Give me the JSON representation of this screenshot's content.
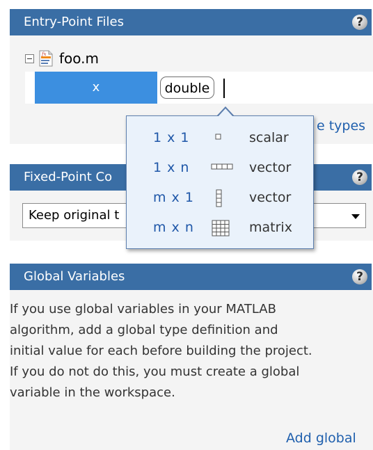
{
  "entry_points": {
    "header": "Entry-Point Files",
    "help": "?",
    "file": "foo.m",
    "variable": "x",
    "type_value": "double",
    "types_link": "e types"
  },
  "fixed_point": {
    "header": "Fixed-Point Co",
    "help": "?",
    "select_value": "Keep original t"
  },
  "size_popup": {
    "options": [
      {
        "dims": "1 x 1",
        "kind": "scalar",
        "icon": "scalar-icon"
      },
      {
        "dims": "1 x n",
        "kind": "vector",
        "icon": "row-vector-icon"
      },
      {
        "dims": "m x 1",
        "kind": "vector",
        "icon": "column-vector-icon"
      },
      {
        "dims": "m x n",
        "kind": "matrix",
        "icon": "matrix-icon"
      }
    ]
  },
  "global_vars": {
    "header": "Global Variables",
    "help": "?",
    "description_lines": [
      "If you use global variables in your MATLAB",
      "algorithm, add a global type definition and",
      "initial value for each before building the project.",
      "If you do not do this, you must create a global",
      "variable in the workspace."
    ],
    "add_link": "Add global"
  },
  "colors": {
    "header_bg": "#3a6ea5",
    "selection": "#3c8fe0",
    "link": "#1f5fad",
    "popup_bg": "#eaf2fb"
  }
}
